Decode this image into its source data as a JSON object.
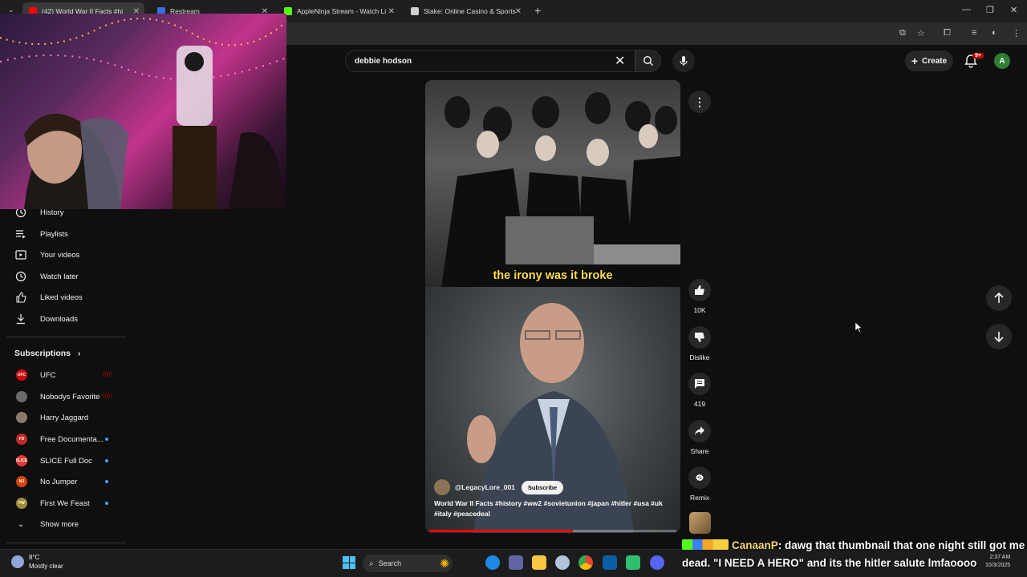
{
  "browser": {
    "tabs": [
      {
        "label": "(42) World War II Facts #hi",
        "active": true
      },
      {
        "label": "Restream",
        "active": false
      },
      {
        "label": "AppleNinja Stream - Watch Li",
        "active": false
      },
      {
        "label": "Stake: Online Casino & Sports",
        "active": false
      }
    ],
    "new_tab": "+"
  },
  "header": {
    "search_value": "debbie hodson",
    "create_label": "Create",
    "notification_count": "9+",
    "avatar_letter": "A"
  },
  "sidebar": {
    "items": [
      {
        "label": "History",
        "icon": "history-icon"
      },
      {
        "label": "Playlists",
        "icon": "playlists-icon"
      },
      {
        "label": "Your videos",
        "icon": "your-videos-icon"
      },
      {
        "label": "Watch later",
        "icon": "watch-later-icon"
      },
      {
        "label": "Liked videos",
        "icon": "liked-videos-icon"
      },
      {
        "label": "Downloads",
        "icon": "downloads-icon"
      }
    ],
    "subscriptions_title": "Subscriptions",
    "subscriptions": [
      {
        "label": "UFC",
        "avatar_text": "UFC",
        "avatar_color": "#d20a0a",
        "status": "live"
      },
      {
        "label": "Nobodys Favorite",
        "avatar_text": "",
        "avatar_color": "#6b6b6b",
        "status": "live"
      },
      {
        "label": "Harry Jaggard",
        "avatar_text": "",
        "avatar_color": "#8a7a6a",
        "status": "none"
      },
      {
        "label": "Free Documenta...",
        "avatar_text": "FD",
        "avatar_color": "#c62828",
        "status": "new"
      },
      {
        "label": "SLICE Full Doc",
        "avatar_text": "SLICE",
        "avatar_color": "#e53935",
        "status": "new"
      },
      {
        "label": "No Jumper",
        "avatar_text": "NJ",
        "avatar_color": "#d84315",
        "status": "new"
      },
      {
        "label": "First We Feast",
        "avatar_text": "FW",
        "avatar_color": "#9e8c3a",
        "status": "new"
      }
    ],
    "show_more": "Show more"
  },
  "short": {
    "caption": "the irony was it broke",
    "channel": "@LegacyLore_001",
    "subscribe_label": "Subscribe",
    "title": "World War II Facts #history #ww2 #sovietunion #japan #hitler #usa #uk #italy #peacedeal",
    "progress": 0.58
  },
  "actions": {
    "like_count": "10K",
    "dislike_label": "Dislike",
    "comment_count": "419",
    "share_label": "Share",
    "remix_label": "Remix"
  },
  "chat": {
    "name": "CanaanP",
    "message": ": dawg that thumbnail that one night still got me dead. \"I NEED A HERO\" and its the hitler salute lmfaoooo"
  },
  "taskbar": {
    "temperature": "8°C",
    "condition": "Mostly clear",
    "search_label": "Search",
    "time": "2:37 AM",
    "date": "10/3/2025"
  },
  "colors": {
    "background": "#0f0f0f",
    "caption": "#ffe045",
    "progress": "#ff0000",
    "notification": "#cc0000",
    "avatar": "#2e7d32"
  }
}
